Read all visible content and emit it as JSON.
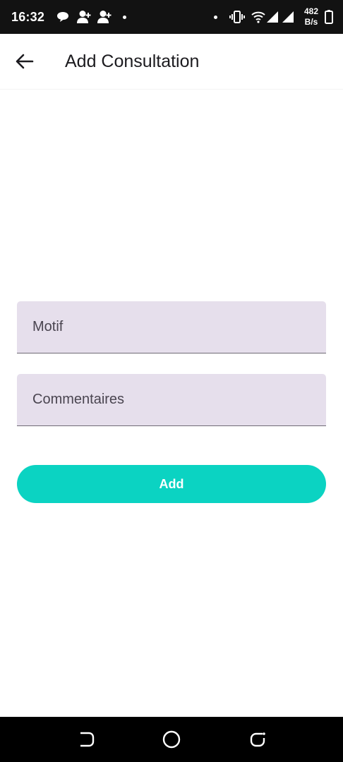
{
  "status_bar": {
    "time": "16:32",
    "net_speed_value": "482",
    "net_speed_unit": "B/s",
    "icons": [
      "chat-bubble-icon",
      "person-add-icon",
      "person-add-icon",
      "dot-icon",
      "dot-icon",
      "vibrate-icon",
      "wifi-icon",
      "signal-icon",
      "signal-icon",
      "battery-icon"
    ]
  },
  "app_bar": {
    "title": "Add Consultation",
    "back_icon": "arrow-left-icon"
  },
  "form": {
    "motif_placeholder": "Motif",
    "motif_value": "",
    "comments_placeholder": "Commentaires",
    "comments_value": "",
    "submit_label": "Add"
  },
  "nav_bar": {
    "icons": [
      "back-nav-icon",
      "home-nav-icon",
      "recents-nav-icon"
    ]
  },
  "colors": {
    "status_bar_bg": "#121212",
    "field_bg": "#e6dfec",
    "accent": "#0bd3c2",
    "nav_bar_bg": "#000000"
  }
}
